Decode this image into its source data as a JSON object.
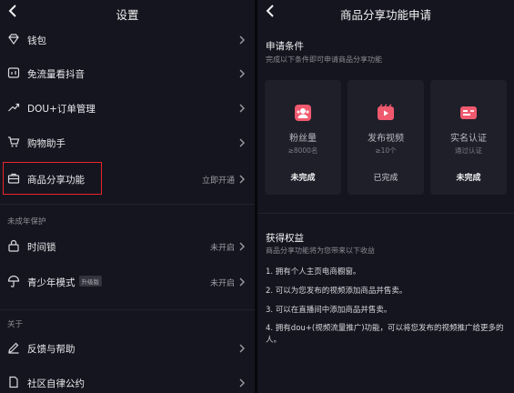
{
  "left": {
    "title": "设置",
    "rows": [
      {
        "label": "钱包",
        "status": "",
        "icon": "diamond-icon"
      },
      {
        "label": "免流量看抖音",
        "status": "",
        "icon": "data-card-icon"
      },
      {
        "label": "DOU+订单管理",
        "status": "",
        "icon": "trend-icon"
      },
      {
        "label": "购物助手",
        "status": "",
        "icon": "cart-icon"
      },
      {
        "label": "商品分享功能",
        "status": "立即开通",
        "icon": "briefcase-icon"
      }
    ],
    "section_youth": "未成年保护",
    "youth_rows": [
      {
        "label": "时间锁",
        "status": "未开启",
        "icon": "lock-icon"
      },
      {
        "label": "青少年模式",
        "badge": "升级版",
        "status": "未开启",
        "icon": "umbrella-icon"
      }
    ],
    "section_about": "关于",
    "about_rows": [
      {
        "label": "反馈与帮助",
        "status": "",
        "icon": "edit-icon"
      },
      {
        "label": "社区自律公约",
        "status": "",
        "icon": "document-icon"
      }
    ]
  },
  "right": {
    "title": "商品分享功能申请",
    "conditions_heading": "申请条件",
    "conditions_sub": "完成以下条件即可申请商品分享功能",
    "cards": [
      {
        "name": "粉丝量",
        "requirement": "≥8000名",
        "status": "未完成",
        "icon": "fans-icon"
      },
      {
        "name": "发布视频",
        "requirement": "≥10个",
        "status": "已完成",
        "icon": "video-icon"
      },
      {
        "name": "实名认证",
        "requirement": "通过认证",
        "status": "未完成",
        "icon": "id-card-icon"
      }
    ],
    "benefits_heading": "获得权益",
    "benefits_sub": "商品分享功能将为您带来以下收益",
    "benefits": [
      "1. 拥有个人主页电商橱窗。",
      "2. 可以为您发布的视频添加商品并售卖。",
      "3. 可以在直播间中添加商品并售卖。",
      "4. 拥有dou+(视频流量推广)功能，可以将您发布的视频推广给更多的人。"
    ]
  },
  "colors": {
    "highlight": "#e8262b",
    "accent_icon": "#f05a6e",
    "background": "#15151f"
  }
}
